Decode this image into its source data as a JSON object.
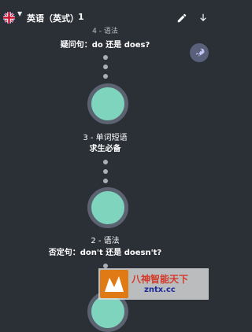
{
  "header": {
    "course_title": "英语（英式）",
    "level": "1",
    "language_flag": "uk-flag",
    "caret_icon": "caret-down-icon",
    "edit_icon": "pencil-icon",
    "download_icon": "download-icon"
  },
  "path": {
    "top_partial_label": "4 - 语法",
    "top_title": "疑问句：do 还是 does?",
    "items": [
      {
        "label": "3 - 单词短语",
        "title": "求生必备"
      },
      {
        "label": "2 - 语法",
        "title": "否定句：don't 还是 doesn't?"
      }
    ]
  },
  "floating_button": {
    "icon": "rocket-icon",
    "color": "#58607a"
  },
  "node_color": "#7fd4bd",
  "watermark": {
    "text": "八神智能天下",
    "url": "zntx.cc"
  }
}
